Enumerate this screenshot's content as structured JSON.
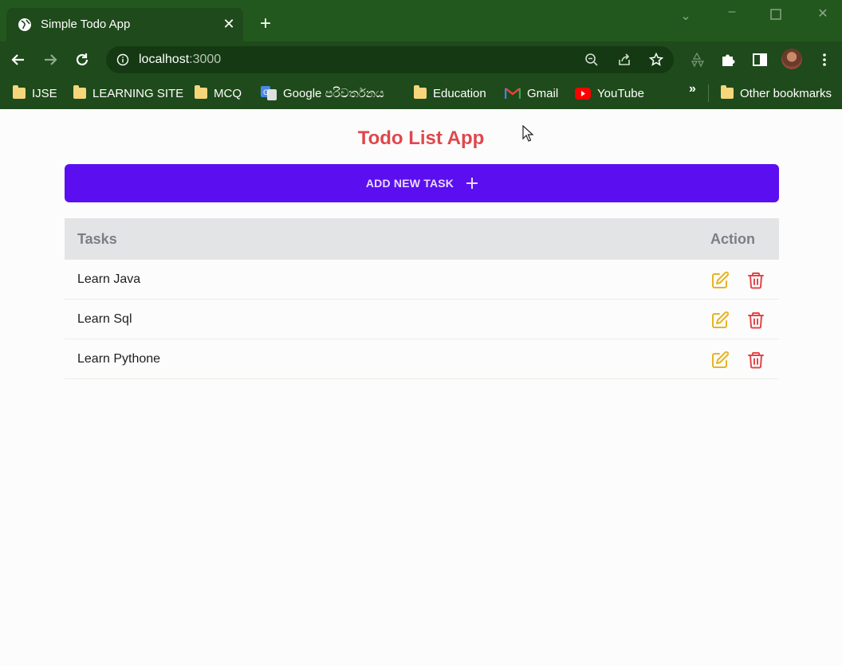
{
  "browser": {
    "tab_title": "Simple Todo App",
    "url_host": "localhost",
    "url_port": ":3000",
    "bookmarks": [
      {
        "label": "IJSE",
        "icon": "folder-icon"
      },
      {
        "label": "LEARNING SITE",
        "icon": "folder-icon"
      },
      {
        "label": "MCQ",
        "icon": "folder-icon"
      },
      {
        "label": "Google පරිවර්තනය",
        "icon": "google-translate-icon"
      },
      {
        "label": "Education",
        "icon": "folder-icon"
      },
      {
        "label": "Gmail",
        "icon": "gmail-icon"
      },
      {
        "label": "YouTube",
        "icon": "youtube-icon"
      }
    ],
    "more_bookmarks": "»",
    "other_bookmarks": "Other bookmarks"
  },
  "app": {
    "title": "Todo List App",
    "add_button_label": "ADD NEW TASK",
    "table": {
      "headers": [
        "Tasks",
        "Action"
      ],
      "rows": [
        {
          "task": "Learn Java"
        },
        {
          "task": "Learn Sql"
        },
        {
          "task": "Learn Pythone"
        }
      ]
    }
  },
  "colors": {
    "accent": "#5b0ff0",
    "title": "#e0474c",
    "edit": "#e8b422",
    "delete": "#e2464b",
    "chrome": "#22581e"
  }
}
